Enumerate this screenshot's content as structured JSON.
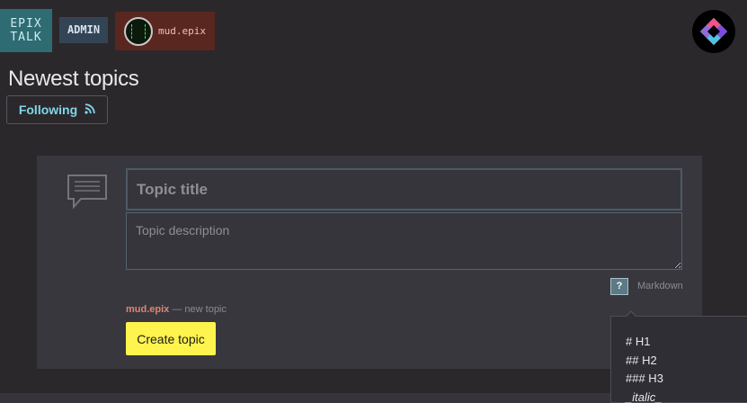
{
  "nav": {
    "brand_line1": "EPIX",
    "brand_line2": "TALK",
    "admin_label": "ADMIN",
    "username": "mud.epix"
  },
  "page": {
    "title": "Newest topics",
    "follow_label": "Following"
  },
  "composer": {
    "title_placeholder": "Topic title",
    "description_placeholder": "Topic description",
    "help_label": "?",
    "markdown_label": "Markdown",
    "author": "mud.epix",
    "author_suffix": " — new topic",
    "submit_label": "Create topic"
  },
  "markdown_help": {
    "items": [
      "# H1",
      "## H2",
      "### H3",
      "_italic_"
    ]
  },
  "icons": {
    "feed": "rss-icon",
    "composer": "speech-bubble-icon",
    "logo": "epix-logo-icon"
  },
  "colors": {
    "background": "#2b282c",
    "panel": "#38373e",
    "brand": "#2f6b72",
    "admin": "#334555",
    "user": "#5a2620",
    "accent_link": "#7fd7e8",
    "submit": "#fff34d",
    "author": "#e08570"
  }
}
